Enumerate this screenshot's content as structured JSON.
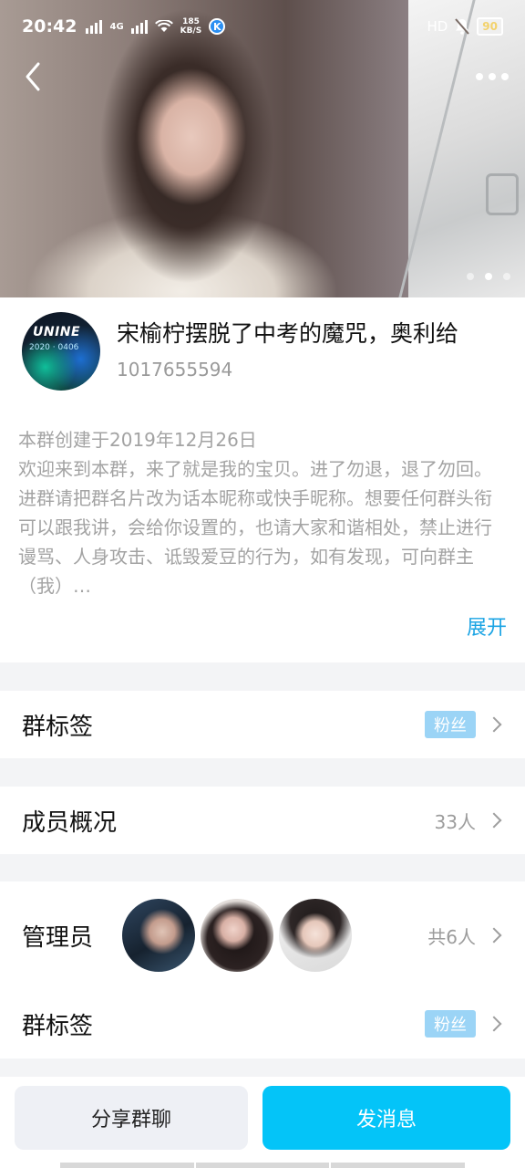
{
  "status_bar": {
    "time": "20:42",
    "network_type": "4G",
    "speed_value": "185",
    "speed_unit": "KB/S",
    "app_badge": "K",
    "hd_label": "HD",
    "battery": "90"
  },
  "header": {
    "back_icon": "chevron-left-icon",
    "more_icon": "more-dots-icon",
    "photo_count": 3,
    "active_photo_index": 1
  },
  "group": {
    "avatar_text": "UNINE",
    "avatar_subtext": "2020 · 0406",
    "name": "宋榆柠摆脱了中考的魔咒，奥利给",
    "id": "1017655594",
    "created": "本群创建于2019年12月26日",
    "description": "欢迎来到本群，来了就是我的宝贝。进了勿退，退了勿回。进群请把群名片改为话本昵称或快手昵称。想要任何群头衔可以跟我讲，会给你设置的，也请大家和谐相处，禁止进行谩骂、人身攻击、诋毁爱豆的行为，如有发现，可向群主（我）…",
    "expand_label": "展开"
  },
  "rows": {
    "tags_label": "群标签",
    "tags_value": "粉丝",
    "members_label": "成员概况",
    "members_value": "33人",
    "admins_label": "管理员",
    "admins_value": "共6人",
    "tags2_label": "群标签",
    "tags2_value": "粉丝"
  },
  "actions": {
    "share_label": "分享群聊",
    "send_label": "发消息"
  },
  "colors": {
    "accent": "#04c4f8",
    "link": "#1ba4e4",
    "tag_bg": "#9bd4f6"
  }
}
